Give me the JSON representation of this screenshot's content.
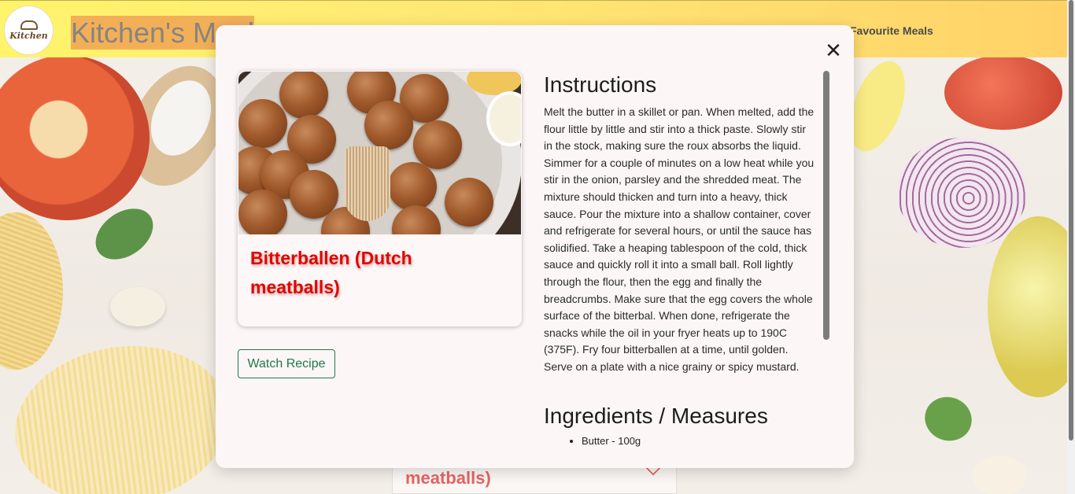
{
  "navbar": {
    "logo_text": "Kitchen",
    "brand": "Kitchen's Meal",
    "favourite_link": "Favourite Meals"
  },
  "background_card": {
    "title": "meatballs)"
  },
  "modal": {
    "meal_title": "Bitterballen (Dutch meatballs)",
    "watch_button": "Watch Recipe",
    "instructions_heading": "Instructions",
    "instructions": "Melt the butter in a skillet or pan. When melted, add the flour little by little and stir into a thick paste. Slowly stir in the stock, making sure the roux absorbs the liquid. Simmer for a couple of minutes on a low heat while you stir in the onion, parsley and the shredded meat. The mixture should thicken and turn into a heavy, thick sauce. Pour the mixture into a shallow container, cover and refrigerate for several hours, or until the sauce has solidified. Take a heaping tablespoon of the cold, thick sauce and quickly roll it into a small ball. Roll lightly through the flour, then the egg and finally the breadcrumbs. Make sure that the egg covers the whole surface of the bitterbal. When done, refrigerate the snacks while the oil in your fryer heats up to 190C (375F). Fry four bitterballen at a time, until golden. Serve on a plate with a nice grainy or spicy mustard.",
    "ingredients_heading": "Ingredients / Measures",
    "ingredients": [
      "Butter - 100g"
    ],
    "close_symbol": "✕"
  },
  "colors": {
    "title_red": "#e10600",
    "button_green": "#1d7a4a",
    "navbar_yellow": "#fff35e",
    "navbar_orange": "#ffcf5c"
  }
}
